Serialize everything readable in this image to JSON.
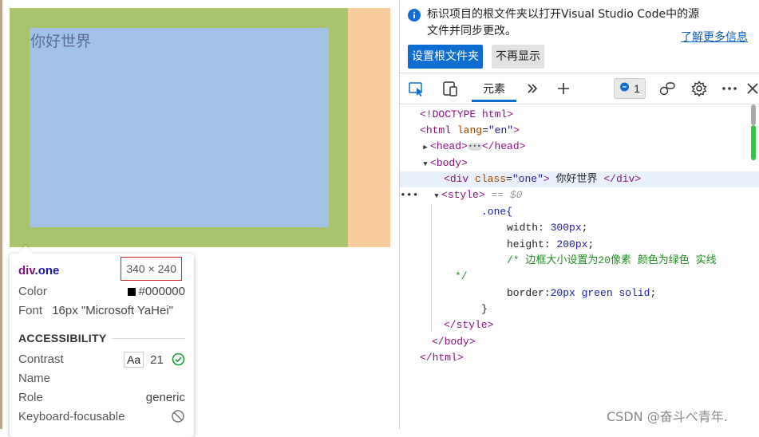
{
  "page": {
    "content_text": "你好世界",
    "colors": {
      "margin": "#f9cc9d",
      "border": "#a9c46c",
      "content": "#a1c3e8"
    }
  },
  "tooltip": {
    "selector_tag": "div",
    "selector_class": ".one",
    "size": "340 × 240",
    "color_label": "Color",
    "color_value": "#000000",
    "font_label": "Font",
    "font_value": "16px \"Microsoft YaHei\"",
    "accessibility_heading": "ACCESSIBILITY",
    "contrast_label": "Contrast",
    "contrast_aa": "Aa",
    "contrast_value": "21",
    "name_label": "Name",
    "role_label": "Role",
    "role_value": "generic",
    "keyboard_label": "Keyboard-focusable"
  },
  "infobar": {
    "message": "标识项目的根文件夹以打开Visual Studio Code中的源文件并同步更改。",
    "learn_more": "了解更多信息",
    "primary_button": "设置根文件夹",
    "secondary_button": "不再显示"
  },
  "toolbar": {
    "inspect_icon": "inspect-icon",
    "device_icon": "device-toolbar-icon",
    "elements_tab": "元素",
    "more_tabs_icon": "chevron-double-right-icon",
    "add_icon": "plus-icon",
    "issues_count": "1",
    "issues_icon": "message-icon",
    "feedback_icon": "feedback-icon",
    "settings_icon": "gear-icon",
    "more_icon": "more-icon",
    "close_icon": "close-icon"
  },
  "dom": {
    "doctype": "<!DOCTYPE html>",
    "html_tag": "html",
    "html_attr": "lang",
    "html_attr_val": "\"en\"",
    "head_tag": "head",
    "body_tag": "body",
    "div_tag": "div",
    "div_attr": "class",
    "div_attr_val": "\"one\"",
    "div_text": "你好世界",
    "style_tag": "style",
    "style_eq": "== $0",
    "css_selector": ".one{",
    "css_width_prop": "width",
    "css_width_val": "300px",
    "css_height_prop": "height",
    "css_height_val": "200px",
    "css_comment_1": "/* 边框大小设置为20像素 颜色为绿色 实线",
    "css_comment_2": "*/",
    "css_border_prop": "border",
    "css_border_val": "20px green solid",
    "css_close": "}"
  },
  "watermark": "CSDN @奋斗べ青年."
}
